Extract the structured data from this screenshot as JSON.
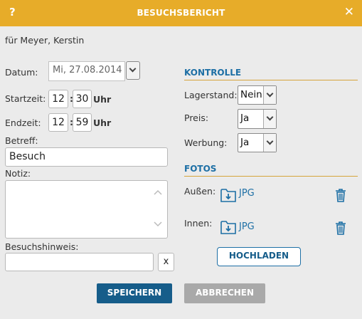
{
  "dialog": {
    "help_glyph": "?",
    "title": "BESUCHSBERICHT",
    "close_glyph": "✕"
  },
  "customer": "für Meyer, Kerstin",
  "form": {
    "date_label": "Datum:",
    "date_value": "Mi, 27.08.2014",
    "start_label": "Startzeit:",
    "start_hour": "12",
    "start_minute": "30",
    "end_label": "Endzeit:",
    "end_hour": "12",
    "end_minute": "59",
    "time_separator": ":",
    "time_unit": "Uhr",
    "subject_label": "Betreff:",
    "subject_value": "Besuch",
    "note_label": "Notiz:",
    "note_value": "",
    "hint_label": "Besuchshinweis:",
    "hint_value": "",
    "clear_label": "x"
  },
  "kontrolle": {
    "heading": "KONTROLLE",
    "stock_label": "Lagerstand:",
    "stock_value": "Nein",
    "price_label": "Preis:",
    "price_value": "Ja",
    "ad_label": "Werbung:",
    "ad_value": "Ja"
  },
  "fotos": {
    "heading": "FOTOS",
    "outside_label": "Außen:",
    "outside_file": "JPG",
    "inside_label": "Innen:",
    "inside_file": "JPG",
    "upload_label": "HOCHLADEN"
  },
  "actions": {
    "save_label": "SPEICHERN",
    "cancel_label": "ABBRECHEN"
  },
  "colors": {
    "titlebar": "#e7ac29",
    "accent_blue": "#1d6fa5",
    "primary_button": "#165d8a",
    "disabled_button": "#a9a9a9",
    "background": "#ebebeb"
  },
  "icons": [
    "help-icon",
    "close-icon",
    "chevron-down-icon",
    "download-folder-icon",
    "trash-icon",
    "scroll-up-icon",
    "scroll-down-icon"
  ]
}
